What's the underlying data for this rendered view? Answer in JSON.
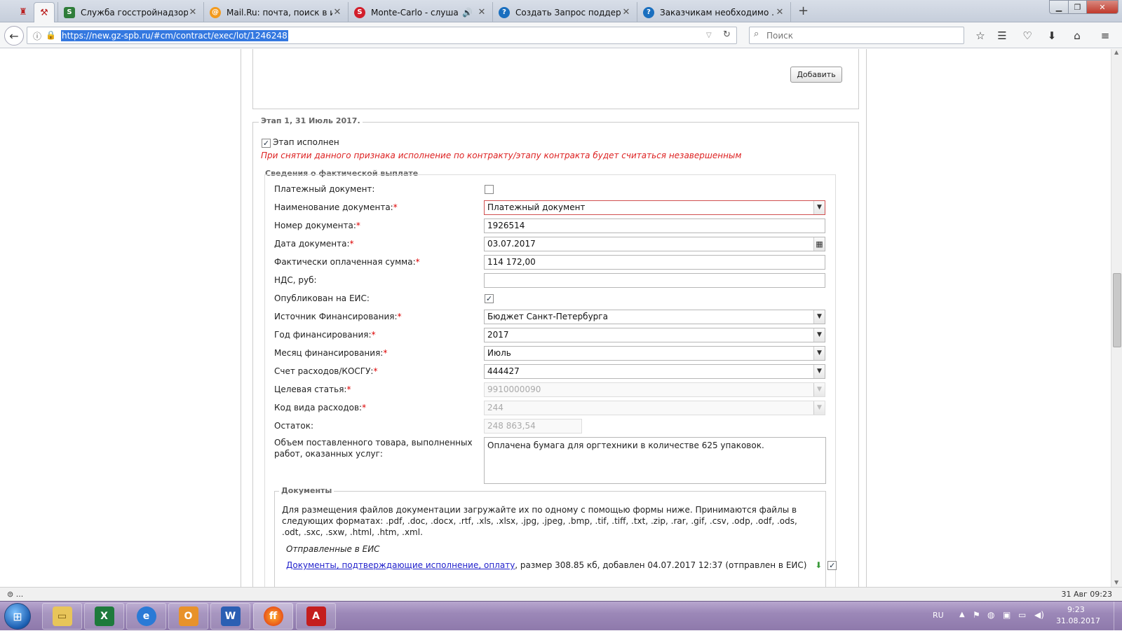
{
  "browser": {
    "tabs": [
      {
        "title": "Служба госстройнадзора ...",
        "favicon": "green-doc-icon",
        "color": "#2f7d3a"
      },
      {
        "title": "Mail.Ru: почта, поиск в ин...",
        "favicon": "mailru-icon",
        "color": "#f39a1c"
      },
      {
        "title": "Monte-Carlo - слушат...",
        "favicon": "radio-icon",
        "color": "#d21e2b"
      },
      {
        "title": "Создать Запрос поддержк...",
        "favicon": "globe-icon",
        "color": "#1a6fbf"
      },
      {
        "title": "Заказчикам необходимо ...",
        "favicon": "globe-icon",
        "color": "#1a6fbf"
      }
    ],
    "url": "https://new.gz-spb.ru/#cm/contract/exec/lot/1246248",
    "search_placeholder": "Поиск",
    "status_left": "⊜ ...",
    "status_right": "31 Авг 09:23"
  },
  "page": {
    "add_button": "Добавить",
    "stage_legend": "Этап 1, 31 Июль 2017.",
    "stage_done_label": "Этап исполнен",
    "stage_done_checked": true,
    "warning": "При снятии данного признака исполнение по контракту/этапу контракта будет считаться незавершенным",
    "payment_legend": "Сведения о фактической выплате",
    "fields": {
      "payment_doc_label": "Платежный документ:",
      "doc_name_label": "Наименование документа:",
      "doc_name_value": "Платежный документ",
      "doc_number_label": "Номер документа:",
      "doc_number_value": "1926514",
      "doc_date_label": "Дата документа:",
      "doc_date_value": "03.07.2017",
      "paid_sum_label": "Фактически оплаченная сумма:",
      "paid_sum_value": "114 172,00",
      "vat_label": "НДС, руб:",
      "vat_value": "",
      "published_label": "Опубликован на ЕИС:",
      "source_label": "Источник Финансирования:",
      "source_value": "Бюджет Санкт-Петербурга",
      "year_label": "Год финансирования:",
      "year_value": "2017",
      "month_label": "Месяц финансирования:",
      "month_value": "Июль",
      "account_label": "Счет расходов/КОСГУ:",
      "account_value": "444427",
      "target_label": "Целевая статья:",
      "target_value": "9910000090",
      "expense_label": "Код вида расходов:",
      "expense_value": "244",
      "remainder_label": "Остаток:",
      "remainder_value": "248 863,54",
      "volume_label": "Объем поставленного товара, выполненных работ, оказанных услуг:",
      "volume_value": "Оплачена бумага для оргтехники в количестве 625 упаковок."
    },
    "docs_legend": "Документы",
    "docs_hint": "Для размещения файлов документации загружайте их по одному с помощью формы ниже. Принимаются файлы в следующих форматах: .pdf, .doc, .docx, .rtf, .xls, .xlsx, .jpg, .jpeg, .bmp, .tif, .tiff, .txt, .zip, .rar, .gif, .csv, .odp, .odf, .ods, .odt, .sxc, .sxw, .html, .htm, .xml.",
    "sent_title": "Отправленные в ЕИС",
    "doc_link": "Документы, подтверждающие исполнение, оплату",
    "doc_info": ", размер 308.85 кб, добавлен 04.07.2017 12:37 (отправлен в ЕИС)"
  },
  "taskbar": {
    "lang": "RU",
    "time": "9:23",
    "date": "31.08.2017"
  }
}
